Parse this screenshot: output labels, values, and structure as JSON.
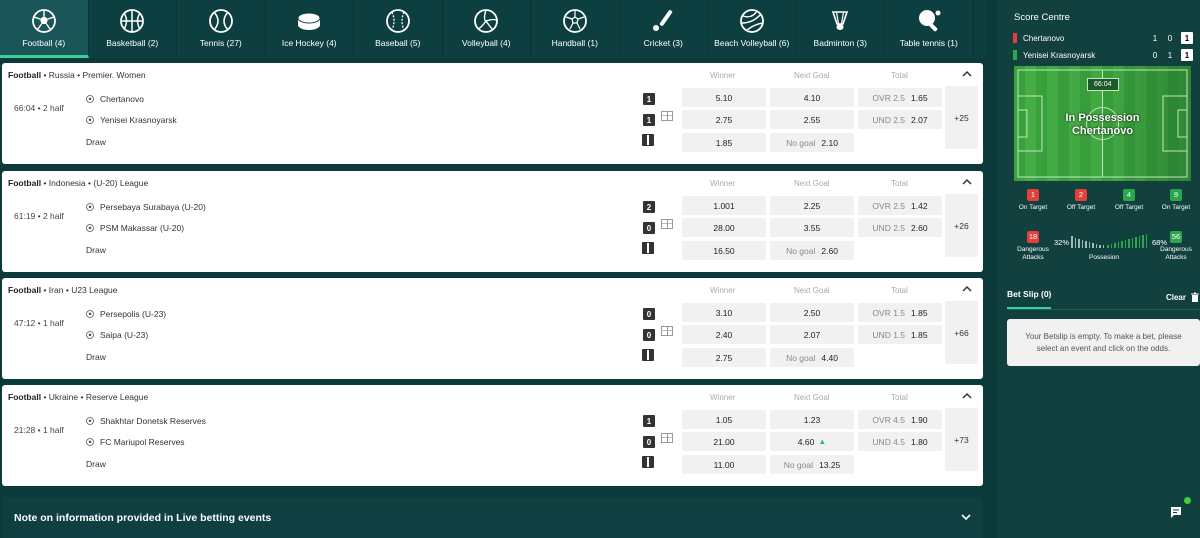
{
  "sports": [
    {
      "icon": "football-icon",
      "label": "Football (4)",
      "active": true
    },
    {
      "icon": "basketball-icon",
      "label": "Basketball (2)"
    },
    {
      "icon": "tennis-icon",
      "label": "Tennis (27)"
    },
    {
      "icon": "ice-hockey-icon",
      "label": "Ice Hockey (4)"
    },
    {
      "icon": "baseball-icon",
      "label": "Baseball (5)"
    },
    {
      "icon": "volleyball-icon",
      "label": "Volleyball (4)"
    },
    {
      "icon": "handball-icon",
      "label": "Handball (1)"
    },
    {
      "icon": "cricket-icon",
      "label": "Cricket (3)"
    },
    {
      "icon": "beach-volleyball-icon",
      "label": "Beach Volleyball (6)"
    },
    {
      "icon": "badminton-icon",
      "label": "Badminton (3)"
    },
    {
      "icon": "table-tennis-icon",
      "label": "Table tennis (1)"
    }
  ],
  "columns": {
    "winner": "Winner",
    "next_goal": "Next Goal",
    "total": "Total"
  },
  "events": [
    {
      "sport": "Football",
      "sep": "•",
      "country": "Russia",
      "league": "Premier. Women",
      "time": "66:04 • 2 half",
      "home": "Chertanovo",
      "away": "Yenisei Krasnoyarsk",
      "draw": "Draw",
      "home_score": "1",
      "away_score": "1",
      "winner": [
        "5.10",
        "2.75",
        "1.85"
      ],
      "next_goal": [
        "4.10",
        "2.55"
      ],
      "no_goal_label": "No goal",
      "no_goal": "2.10",
      "total": [
        {
          "label": "OVR 2.5",
          "odd": "1.65"
        },
        {
          "label": "UND 2.5",
          "odd": "2.07"
        }
      ],
      "more": "+25"
    },
    {
      "sport": "Football",
      "sep": "•",
      "country": "Indonesia",
      "league": "(U-20) League",
      "time": "61:19 • 2 half",
      "home": "Persebaya Surabaya (U-20)",
      "away": "PSM Makassar (U-20)",
      "draw": "Draw",
      "home_score": "2",
      "away_score": "0",
      "winner": [
        "1.001",
        "28.00",
        "16.50"
      ],
      "next_goal": [
        "2.25",
        "3.55"
      ],
      "no_goal_label": "No goal",
      "no_goal": "2.60",
      "total": [
        {
          "label": "OVR 2.5",
          "odd": "1.42"
        },
        {
          "label": "UND 2.5",
          "odd": "2.60"
        }
      ],
      "more": "+26"
    },
    {
      "sport": "Football",
      "sep": "•",
      "country": "Iran",
      "league": "U23 League",
      "time": "47:12 • 1 half",
      "home": "Persepolis (U-23)",
      "away": "Saipa (U-23)",
      "draw": "Draw",
      "home_score": "0",
      "away_score": "0",
      "winner": [
        "3.10",
        "2.40",
        "2.75"
      ],
      "next_goal": [
        "2.50",
        "2.07"
      ],
      "no_goal_label": "No goal",
      "no_goal": "4.40",
      "total": [
        {
          "label": "OVR 1.5",
          "odd": "1.85"
        },
        {
          "label": "UND 1.5",
          "odd": "1.85"
        }
      ],
      "more": "+66"
    },
    {
      "sport": "Football",
      "sep": "•",
      "country": "Ukraine",
      "league": "Reserve League",
      "time": "21:28 • 1 half",
      "home": "Shakhtar Donetsk Reserves",
      "away": "FC Mariupol Reserves",
      "draw": "Draw",
      "home_score": "1",
      "away_score": "0",
      "winner": [
        "1.05",
        "21.00",
        "11.00"
      ],
      "next_goal": [
        "1.23",
        "4.60"
      ],
      "no_goal_label": "No goal",
      "no_goal": "13.25",
      "total": [
        {
          "label": "OVR 4.5",
          "odd": "1.90"
        },
        {
          "label": "UND 4.5",
          "odd": "1.80"
        }
      ],
      "more": "+73"
    }
  ],
  "note": "Note on information provided in Live betting events",
  "score_centre": {
    "title": "Score Centre",
    "home": {
      "name": "Chertanovo",
      "s1": "1",
      "s2": "0",
      "s3": "1",
      "color": "#e23f3f"
    },
    "away": {
      "name": "Yenisei Krasnoyarsk",
      "s1": "0",
      "s2": "1",
      "s3": "1",
      "color": "#2aa74e"
    },
    "clock": "66:04",
    "possession_line1": "In Possession",
    "possession_line2": "Chertanovo",
    "stats": [
      {
        "value": "1",
        "label": "On Target",
        "color": "red"
      },
      {
        "value": "2",
        "label": "Off Target",
        "color": "red"
      },
      {
        "value": "4",
        "label": "Off Target",
        "color": "green"
      },
      {
        "value": "9",
        "label": "On Target",
        "color": "green"
      }
    ],
    "dangerous_home": {
      "value": "18",
      "label": "Dangerous Attacks"
    },
    "dangerous_away": {
      "value": "56",
      "label": "Dangerous Attacks"
    },
    "possession_home": "32%",
    "possession_away": "68%",
    "possession_label": "Possesion"
  },
  "betslip": {
    "tab": "Bet Slip (0)",
    "clear": "Clear",
    "empty": "Your Betslip is empty. To make a bet, please select an event and click on the odds."
  }
}
